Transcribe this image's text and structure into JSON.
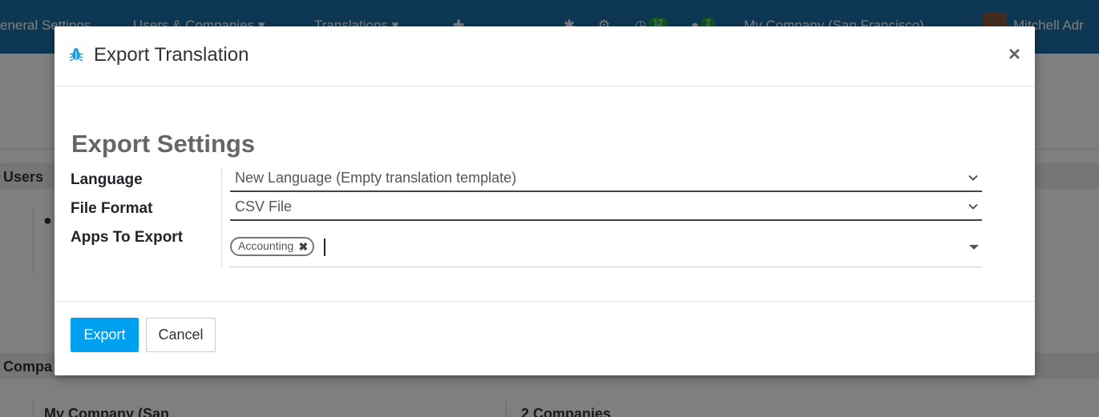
{
  "background": {
    "menu": [
      "eneral Settings",
      "Users & Companies ▾",
      "Translations ▾",
      "✚"
    ],
    "badges": [
      "12",
      "2"
    ],
    "company": "My Company (San Francisco)",
    "user": "Mitchell Adr",
    "sections": [
      "Users",
      "Compa"
    ],
    "cards": [
      "My Company (San",
      "2 Companies"
    ]
  },
  "modal": {
    "title": "Export Translation",
    "close_label": "×",
    "section_title": "Export Settings",
    "fields": {
      "language": {
        "label": "Language",
        "value": "New Language (Empty translation template)"
      },
      "file_format": {
        "label": "File Format",
        "value": "CSV File"
      },
      "apps": {
        "label": "Apps To Export",
        "tags": [
          "Accounting"
        ],
        "tag_remove": "✖"
      }
    },
    "buttons": {
      "export": "Export",
      "cancel": "Cancel"
    }
  },
  "colors": {
    "primary": "#00a0f0",
    "navbar": "#1c6fa8",
    "bug_icon": "#1f9bde"
  },
  "icons": [
    "bug-icon",
    "close-icon",
    "chevron-down-icon",
    "caret-down-icon",
    "tag-remove-icon"
  ]
}
